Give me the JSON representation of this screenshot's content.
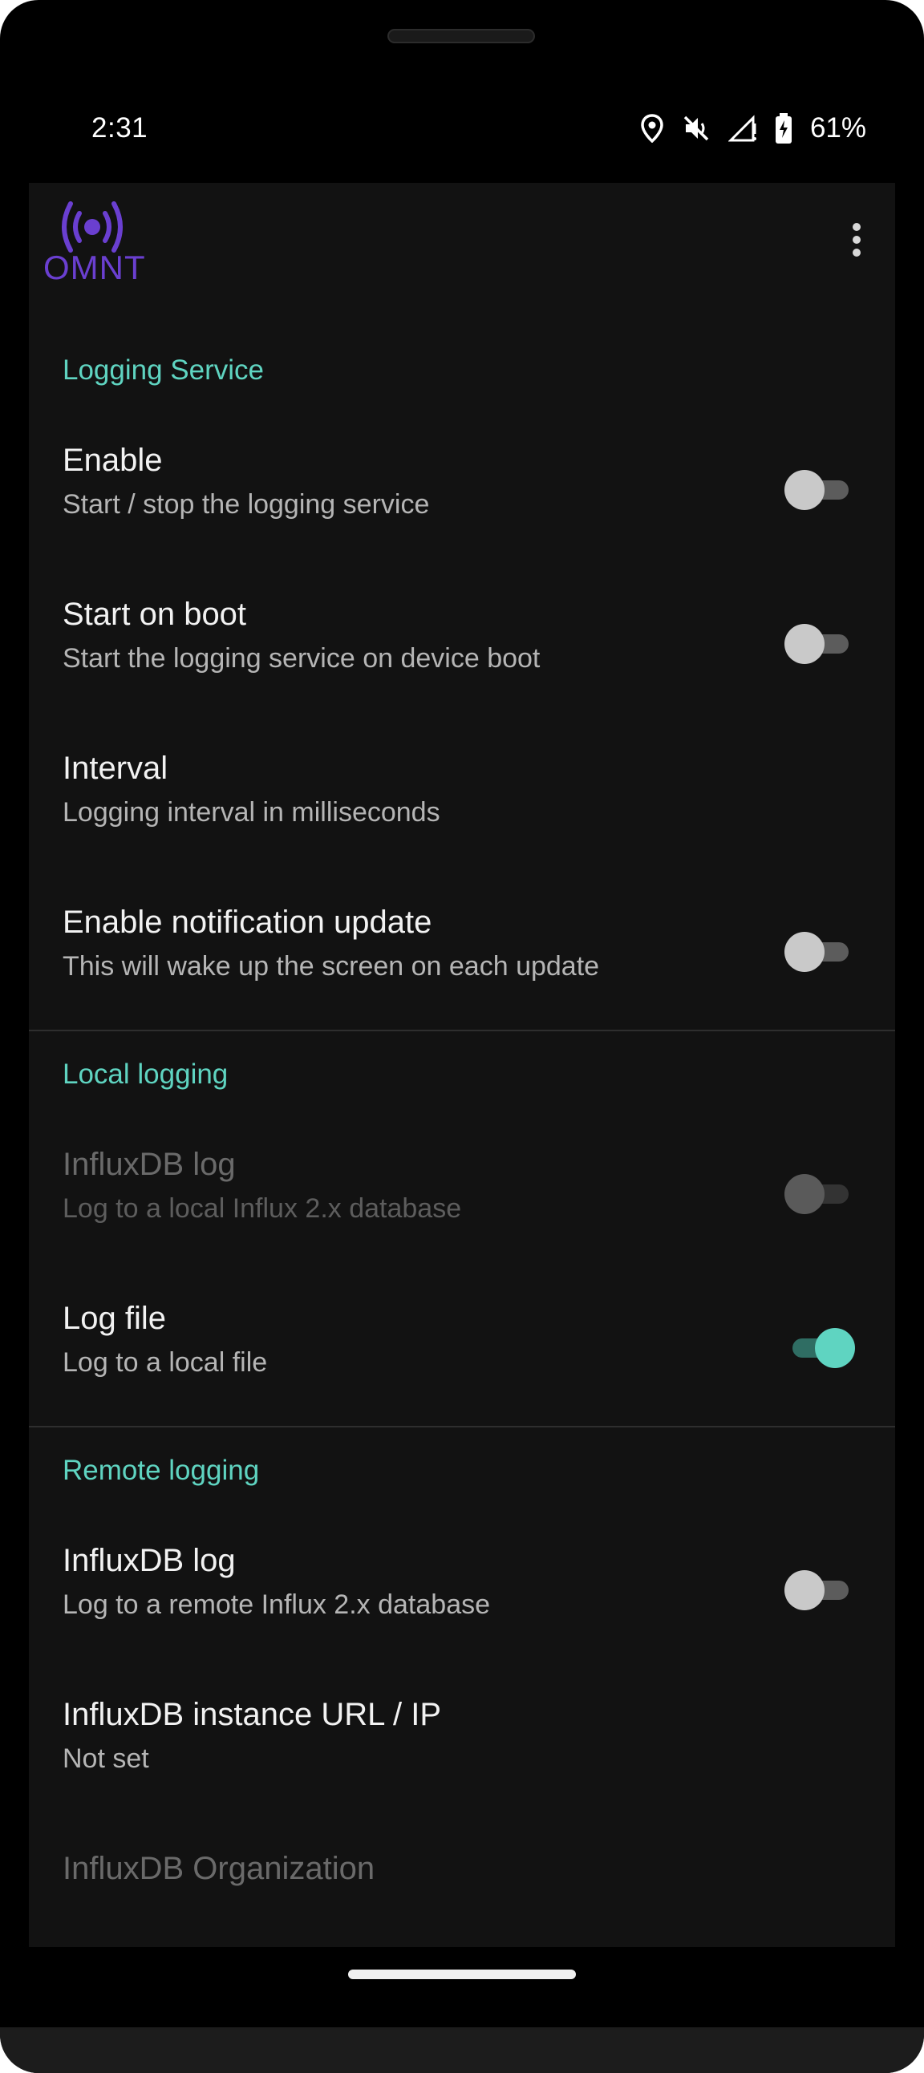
{
  "status_bar": {
    "time": "2:31",
    "battery_percent": "61%",
    "icons": [
      "location-icon",
      "mute-icon",
      "signal-icon",
      "battery-charging-icon"
    ]
  },
  "app_bar": {
    "logo_text": "OMNT",
    "logo_color": "#6a3fd0",
    "menu_icon": "overflow-menu-icon"
  },
  "colors": {
    "accent": "#5fd4c1",
    "background": "#121212"
  },
  "sections": {
    "logging_service": {
      "title": "Logging Service",
      "enable": {
        "title": "Enable",
        "summary": "Start / stop the logging service",
        "on": false
      },
      "start_on_boot": {
        "title": "Start on boot",
        "summary": "Start the logging service on device boot",
        "on": false
      },
      "interval": {
        "title": "Interval",
        "summary": "Logging interval in milliseconds"
      },
      "notification_update": {
        "title": "Enable notification update",
        "summary": "This will wake up the screen on each update",
        "on": false
      }
    },
    "local_logging": {
      "title": "Local logging",
      "influxdb_log": {
        "title": "InfluxDB log",
        "summary": "Log to a local Influx 2.x database",
        "on": false,
        "enabled": false
      },
      "log_file": {
        "title": "Log file",
        "summary": "Log to a local file",
        "on": true
      }
    },
    "remote_logging": {
      "title": "Remote logging",
      "influxdb_log": {
        "title": "InfluxDB log",
        "summary": "Log to a remote Influx 2.x database",
        "on": false
      },
      "instance_url": {
        "title": "InfluxDB instance URL / IP",
        "summary": "Not set"
      },
      "organization": {
        "title": "InfluxDB Organization"
      }
    }
  }
}
